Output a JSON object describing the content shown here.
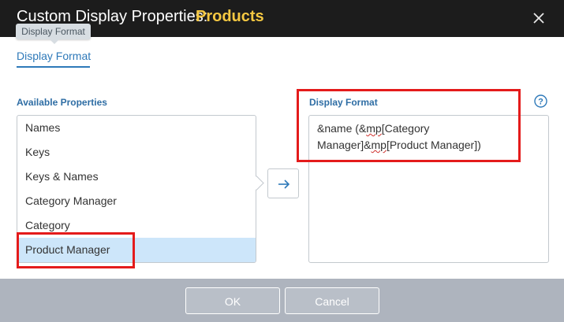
{
  "dialog": {
    "title_prefix": "Custom Display Properties:",
    "title_object": "Products",
    "close_icon": "close-icon"
  },
  "tooltip": {
    "text": "Display Format"
  },
  "tabs": [
    {
      "label": "Display Format",
      "active": true
    }
  ],
  "available_properties": {
    "label": "Available Properties",
    "items": [
      {
        "label": "Names",
        "selected": false
      },
      {
        "label": "Keys",
        "selected": false
      },
      {
        "label": "Keys & Names",
        "selected": false
      },
      {
        "label": "Category Manager",
        "selected": false
      },
      {
        "label": "Category",
        "selected": false
      },
      {
        "label": "Product Manager",
        "selected": true
      }
    ]
  },
  "add_button": {
    "icon": "arrow-right-icon"
  },
  "display_format": {
    "label": "Display Format",
    "help_icon": "help-icon",
    "segments": [
      {
        "text": "&name (&",
        "spellcheck": false
      },
      {
        "text": "mp",
        "spellcheck": true
      },
      {
        "text": "[Category Manager]&",
        "spellcheck": false
      },
      {
        "text": "mp",
        "spellcheck": true
      },
      {
        "text": "[Product Manager])",
        "spellcheck": false
      }
    ]
  },
  "footer": {
    "ok_label": "OK",
    "cancel_label": "Cancel"
  },
  "colors": {
    "title_bg": "#1c1c1c",
    "title_accent": "#f5c842",
    "link_blue": "#2e79b9",
    "selected_row": "#cde6fa",
    "footer_bg": "#aeb4be",
    "annotation_red": "#e41b1b"
  }
}
